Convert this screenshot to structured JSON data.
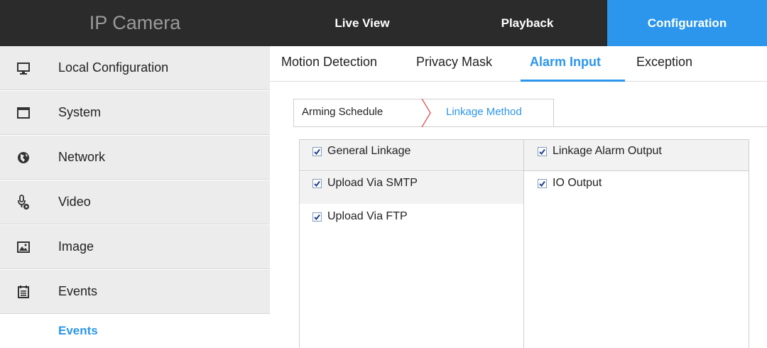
{
  "app": {
    "title": "IP Camera"
  },
  "topnav": {
    "live_view": "Live View",
    "playback": "Playback",
    "configuration": "Configuration"
  },
  "sidebar": {
    "items": [
      {
        "label": "Local Configuration",
        "icon": "monitor-icon"
      },
      {
        "label": "System",
        "icon": "window-icon"
      },
      {
        "label": "Network",
        "icon": "globe-icon"
      },
      {
        "label": "Video",
        "icon": "microphone-icon"
      },
      {
        "label": "Image",
        "icon": "image-icon"
      },
      {
        "label": "Events",
        "icon": "calendar-icon"
      }
    ],
    "sub_item": "Events"
  },
  "tabs": [
    {
      "label": "Motion Detection",
      "active": false
    },
    {
      "label": "Privacy Mask",
      "active": false
    },
    {
      "label": "Alarm Input",
      "active": true
    },
    {
      "label": "Exception",
      "active": false
    }
  ],
  "subtabs": {
    "arming_schedule": "Arming Schedule",
    "linkage_method": "Linkage Method"
  },
  "linkage": {
    "general_header": "General Linkage",
    "alarm_header": "Linkage Alarm Output",
    "upload_smtp": "Upload Via SMTP",
    "upload_ftp": "Upload Via FTP",
    "io_output": "IO Output",
    "checked": {
      "general": true,
      "alarm": true,
      "smtp": true,
      "ftp": true,
      "io": true
    }
  },
  "colors": {
    "accent": "#2b96ec",
    "topbar": "#2b2b2b",
    "sidebar_bg": "#ececec"
  }
}
